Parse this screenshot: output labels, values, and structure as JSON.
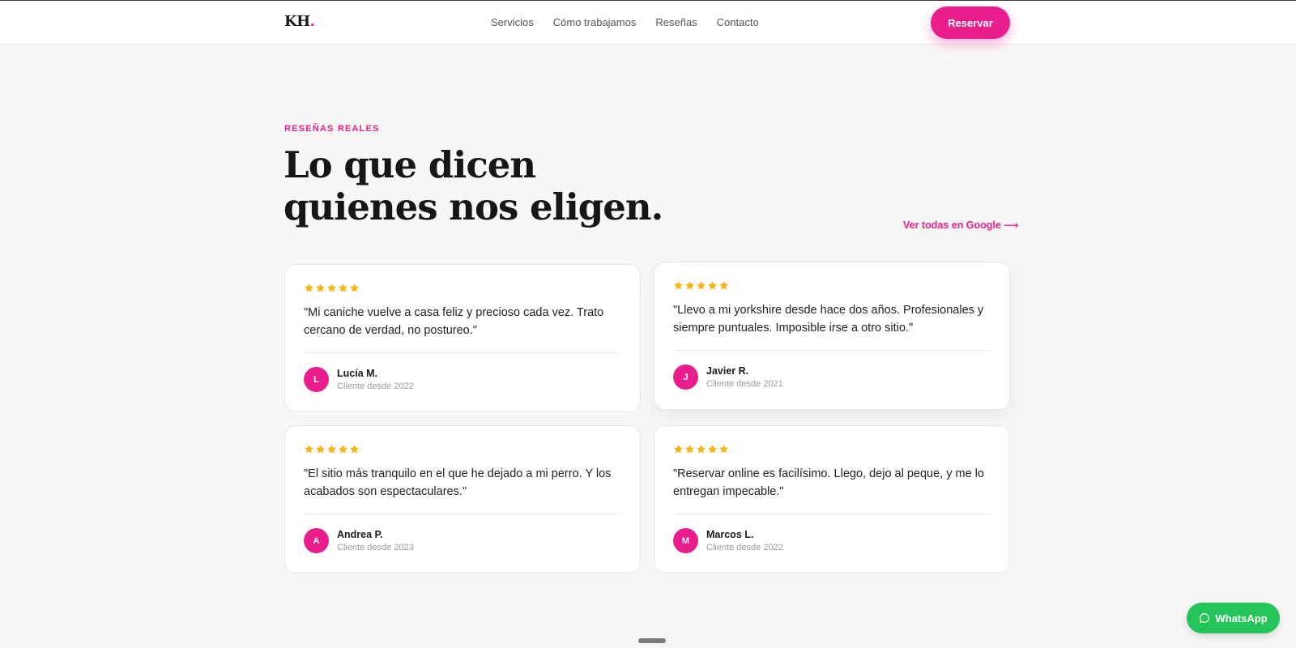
{
  "header": {
    "logo_text": "KH",
    "logo_dot": ".",
    "nav": [
      "Servicios",
      "Cómo trabajamos",
      "Reseñas",
      "Contacto"
    ],
    "cta_label": "Reservar"
  },
  "section": {
    "eyebrow": "RESEÑAS REALES",
    "title_line1": "Lo que dicen",
    "title_line2": "quienes nos eligen.",
    "google_link": "Ver todas en Google ⟶"
  },
  "reviews": [
    {
      "rating": 5,
      "quote": "\"Mi caniche vuelve a casa feliz y precioso cada vez. Trato cercano de verdad, no postureo.\"",
      "initial": "L",
      "author": "Lucía M.",
      "since": "Cliente desde 2022"
    },
    {
      "rating": 5,
      "quote": "\"Llevo a mi yorkshire desde hace dos años. Profesionales y siempre puntuales. Imposible irse a otro sitio.\"",
      "initial": "J",
      "author": "Javier R.",
      "since": "Cliente desde 2021"
    },
    {
      "rating": 5,
      "quote": "\"El sitio más tranquilo en el que he dejado a mi perro. Y los acabados son espectaculares.\"",
      "initial": "A",
      "author": "Andrea P.",
      "since": "Cliente desde 2023"
    },
    {
      "rating": 5,
      "quote": "\"Reservar online es facilísimo. Llego, dejo al peque, y me lo entregan impecable.\"",
      "initial": "M",
      "author": "Marcos L.",
      "since": "Cliente desde 2022"
    }
  ],
  "whatsapp": {
    "label": "WhatsApp",
    "icon": "chat-bubble-icon"
  },
  "colors": {
    "accent": "#e91e8c",
    "star": "#f5b614",
    "whatsapp": "#25c45a",
    "background": "#f8f7f5"
  }
}
